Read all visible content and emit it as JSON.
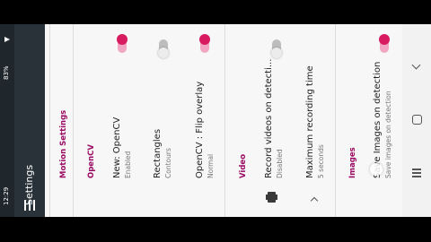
{
  "status": {
    "time": "12:29",
    "battery": "83%"
  },
  "app_bar": {
    "title": "Settings"
  },
  "settings": {
    "header": "Motion Settings",
    "opencv_section": "OpenCV",
    "new_opencv": {
      "title": "New: OpenCV",
      "subtitle": "Enabled",
      "on": true
    },
    "rectangles": {
      "title": "Rectangles",
      "subtitle": "Contours",
      "on": false
    },
    "flip_overlay": {
      "title": "OpenCV : Flip overlay",
      "subtitle": "Normal",
      "on": true
    },
    "video_section": "Video",
    "record_videos": {
      "title": "Record videos on detecti...",
      "subtitle": "Disabled",
      "on": false
    },
    "max_recording": {
      "title": "Maximum recording time",
      "subtitle": "5 seconds"
    },
    "images_section": "Images",
    "save_images": {
      "title": "Save Images on detection",
      "subtitle": "Save images on detection",
      "on": true
    }
  },
  "navigation": {
    "back": "back-icon",
    "home": "home-icon",
    "recents": "recents-icon"
  },
  "colors": {
    "accent": "#d81b60",
    "section": "#9a0b63",
    "appbar": "#283238"
  }
}
